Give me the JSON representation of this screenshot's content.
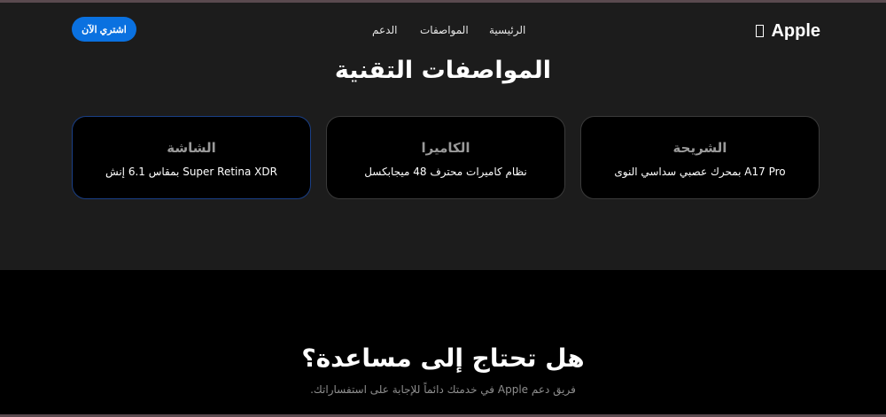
{
  "header": {
    "logo_text": "Apple",
    "logo_icon": "apple-logo-icon",
    "nav": {
      "home": "الرئيسية",
      "specs": "المواصفات",
      "support": "الدعم"
    },
    "buy_label": "اشتري الآن"
  },
  "specs": {
    "title": "المواصفات التقنية",
    "cards": [
      {
        "title": "الشريحة",
        "desc": "A17 Pro بمحرك عصبي سداسي النوى"
      },
      {
        "title": "الكاميرا",
        "desc": "نظام كاميرات محترف 48 ميجابكسل"
      },
      {
        "title": "الشاشة",
        "desc": "Super Retina XDR بمقاس 6.1 إنش"
      }
    ]
  },
  "help": {
    "title": "هل تحتاج إلى مساعدة؟",
    "subtitle": "فريق دعم Apple في خدمتك دائماً للإجابة على استفساراتك."
  },
  "colors": {
    "accent": "#0a71e0",
    "page_bg": "#1c1c1c",
    "card_bg": "#000000",
    "active_card_border": "#1a3f86"
  }
}
